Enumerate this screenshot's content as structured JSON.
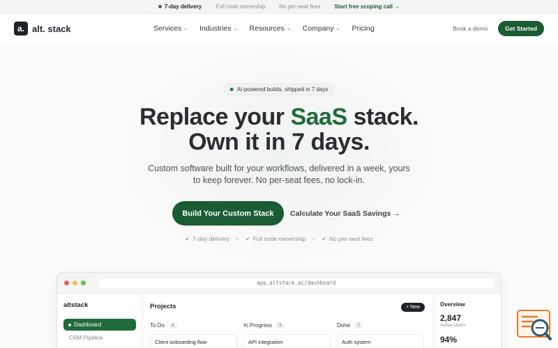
{
  "topbar": {
    "delivery": "7-day delivery",
    "ownership": "Full code ownership",
    "fees": "No per-seat fees",
    "cta": "Start free scoping call →"
  },
  "nav": {
    "logo_mark": "a.",
    "logo_text": "alt. stack",
    "menu": [
      "Services",
      "Industries",
      "Resources",
      "Company",
      "Pricing"
    ],
    "book_demo": "Book a demo",
    "get_started": "Get Started"
  },
  "hero": {
    "pill": "AI-powered builds, shipped in 7 days",
    "title_part1": "Replace your ",
    "title_accent": "SaaS",
    "title_part2": " stack.",
    "title_line2": "Own it in 7 days.",
    "subtitle_line1": "Custom software built for your workflows, delivered in a week, yours",
    "subtitle_line2": "to keep forever. No per-seat fees, no lock-in.",
    "primary_cta": "Build Your Custom Stack",
    "secondary_cta": "Calculate Your SaaS Savings →",
    "checks": [
      "7-day delivery",
      "Full code ownership",
      "No per-seat fees"
    ]
  },
  "app": {
    "url": "app.altstack.ai/dashboard",
    "sidebar": {
      "brand": "altstack",
      "active": "Dashboard",
      "items": [
        "CRM Pipeline"
      ]
    },
    "projects": {
      "title": "Projects",
      "new_button": "+ New",
      "columns": [
        {
          "name": "To Do",
          "count": "4",
          "card": "Client onboarding flow",
          "tag_color": "#2f6fdb"
        },
        {
          "name": "In Progress",
          "count": "3",
          "card": "API integration",
          "tag_color": "#9aa0a6"
        },
        {
          "name": "Done",
          "count": "7",
          "card": "Auth system",
          "tag_color": "#d93a3a"
        }
      ]
    },
    "overview": {
      "title": "Overview",
      "stat1_value": "2,847",
      "stat1_label": "Active Users",
      "stat2_value": "94%"
    }
  },
  "colors": {
    "brand_green": "#1a5c34",
    "accent_green": "#1f6b3a",
    "widget_orange": "#e8782c",
    "widget_teal": "#2a5a63"
  },
  "icons": {
    "window_lights": [
      "#ef5b5b",
      "#f5bf4f",
      "#61c454"
    ],
    "chat_widget": "support-chat-icon"
  }
}
